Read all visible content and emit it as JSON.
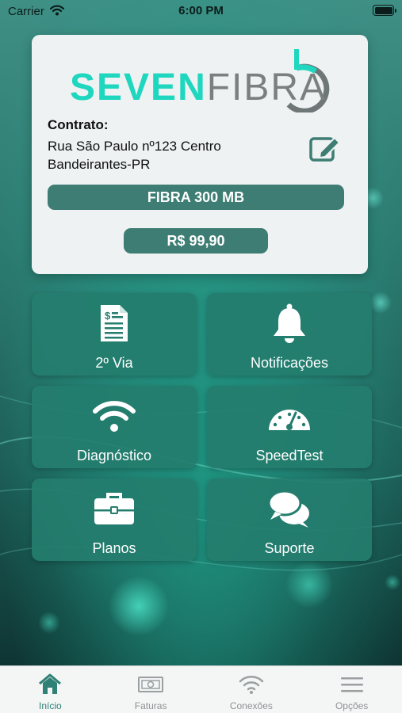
{
  "status_bar": {
    "carrier": "Carrier",
    "time": "6:00 PM"
  },
  "card": {
    "logo": {
      "part1": "SEVEN",
      "part2": "FIBRA"
    },
    "contract_label": "Contrato:",
    "address_line1": "Rua São Paulo nº123 Centro",
    "address_line2": "Bandeirantes-PR",
    "plan": "FIBRA 300 MB",
    "price": "R$ 99,90"
  },
  "tiles": [
    {
      "label": "2º Via",
      "icon": "invoice-document-icon"
    },
    {
      "label": "Notificações",
      "icon": "bell-icon"
    },
    {
      "label": "Diagnóstico",
      "icon": "wifi-icon"
    },
    {
      "label": "SpeedTest",
      "icon": "speedometer-icon"
    },
    {
      "label": "Planos",
      "icon": "briefcase-icon"
    },
    {
      "label": "Suporte",
      "icon": "chat-bubbles-icon"
    }
  ],
  "tab_bar": [
    {
      "label": "Início",
      "icon": "home-icon",
      "active": true
    },
    {
      "label": "Faturas",
      "icon": "banknote-icon",
      "active": false
    },
    {
      "label": "Conexões",
      "icon": "wifi-icon",
      "active": false
    },
    {
      "label": "Opções",
      "icon": "menu-icon",
      "active": false
    }
  ],
  "colors": {
    "accent": "#2f8075",
    "tile": "#247d6e",
    "logo_seven": "#1fd6bf",
    "logo_fibra": "#7a7f80",
    "pill": "#3d7d73"
  }
}
